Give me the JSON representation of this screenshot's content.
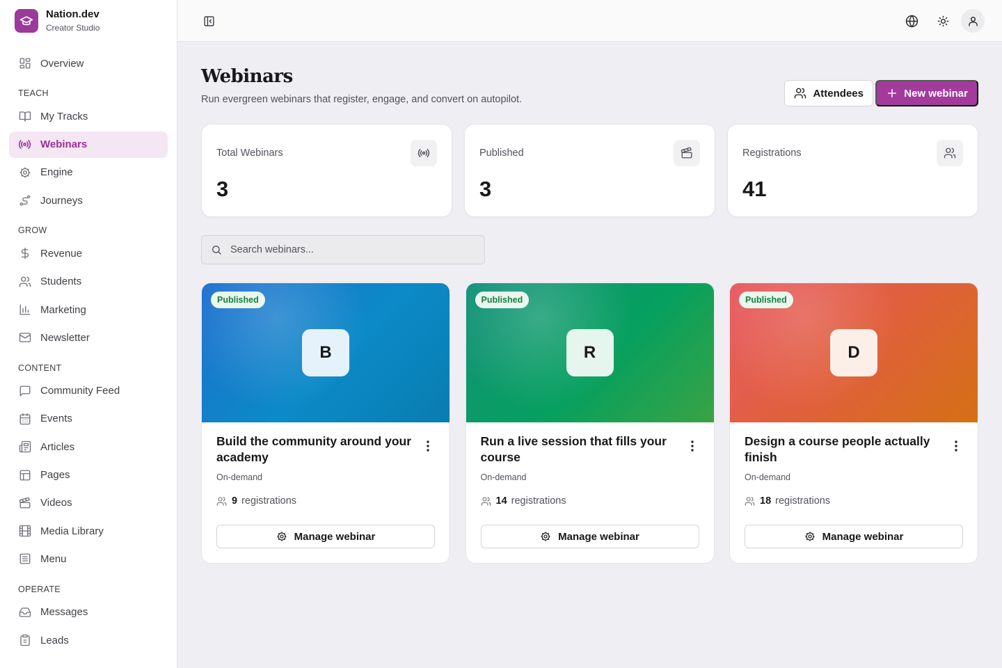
{
  "brand": {
    "name": "Nation.dev",
    "subtitle": "Creator Studio",
    "logo_icon": "graduation-cap-icon",
    "accent": "#9b3a9b"
  },
  "sidebar": {
    "overview": {
      "label": "Overview",
      "icon": "grid-icon"
    },
    "sections": [
      {
        "title": "TEACH",
        "items": [
          {
            "label": "My Tracks",
            "icon": "book-icon"
          },
          {
            "label": "Webinars",
            "icon": "broadcast-icon",
            "active": true
          },
          {
            "label": "Engine",
            "icon": "gear-icon"
          },
          {
            "label": "Journeys",
            "icon": "route-icon"
          }
        ]
      },
      {
        "title": "GROW",
        "items": [
          {
            "label": "Revenue",
            "icon": "dollar-icon"
          },
          {
            "label": "Students",
            "icon": "users-icon"
          },
          {
            "label": "Marketing",
            "icon": "bar-chart-icon"
          },
          {
            "label": "Newsletter",
            "icon": "mail-icon"
          }
        ]
      },
      {
        "title": "CONTENT",
        "items": [
          {
            "label": "Community Feed",
            "icon": "message-square-icon"
          },
          {
            "label": "Events",
            "icon": "calendar-icon"
          },
          {
            "label": "Articles",
            "icon": "newspaper-icon"
          },
          {
            "label": "Pages",
            "icon": "layout-icon"
          },
          {
            "label": "Videos",
            "icon": "clapperboard-icon"
          },
          {
            "label": "Media Library",
            "icon": "film-icon"
          },
          {
            "label": "Menu",
            "icon": "list-icon"
          }
        ]
      },
      {
        "title": "OPERATE",
        "items": [
          {
            "label": "Messages",
            "icon": "inbox-icon"
          },
          {
            "label": "Leads",
            "icon": "clipboard-icon"
          }
        ]
      }
    ]
  },
  "topbar": {
    "toggle_icon": "sidebar-toggle-icon",
    "language_icon": "globe-icon",
    "theme_icon": "sun-icon",
    "user_icon": "user-icon"
  },
  "page": {
    "title": "Webinars",
    "subtitle": "Run evergreen webinars that register, engage, and convert on autopilot.",
    "attendees_label": "Attendees",
    "new_label": "New webinar"
  },
  "stats": [
    {
      "label": "Total Webinars",
      "value": "3",
      "icon": "broadcast-icon"
    },
    {
      "label": "Published",
      "value": "3",
      "icon": "clapperboard-icon"
    },
    {
      "label": "Registrations",
      "value": "41",
      "icon": "users-icon"
    }
  ],
  "search": {
    "placeholder": "Search webinars...",
    "value": ""
  },
  "webinars": [
    {
      "status": "Published",
      "letter": "B",
      "title": "Build the community around your academy",
      "type": "On-demand",
      "registrations": "9",
      "reg_label": "registrations",
      "manage_label": "Manage webinar",
      "theme": "blue"
    },
    {
      "status": "Published",
      "letter": "R",
      "title": "Run a live session that fills your course",
      "type": "On-demand",
      "registrations": "14",
      "reg_label": "registrations",
      "manage_label": "Manage webinar",
      "theme": "green"
    },
    {
      "status": "Published",
      "letter": "D",
      "title": "Design a course people actually finish",
      "type": "On-demand",
      "registrations": "18",
      "reg_label": "registrations",
      "manage_label": "Manage webinar",
      "theme": "orange"
    }
  ],
  "colors": {
    "primary": "#a23b9c",
    "active_bg": "#f5e6f3",
    "published_badge": "#15803d"
  }
}
